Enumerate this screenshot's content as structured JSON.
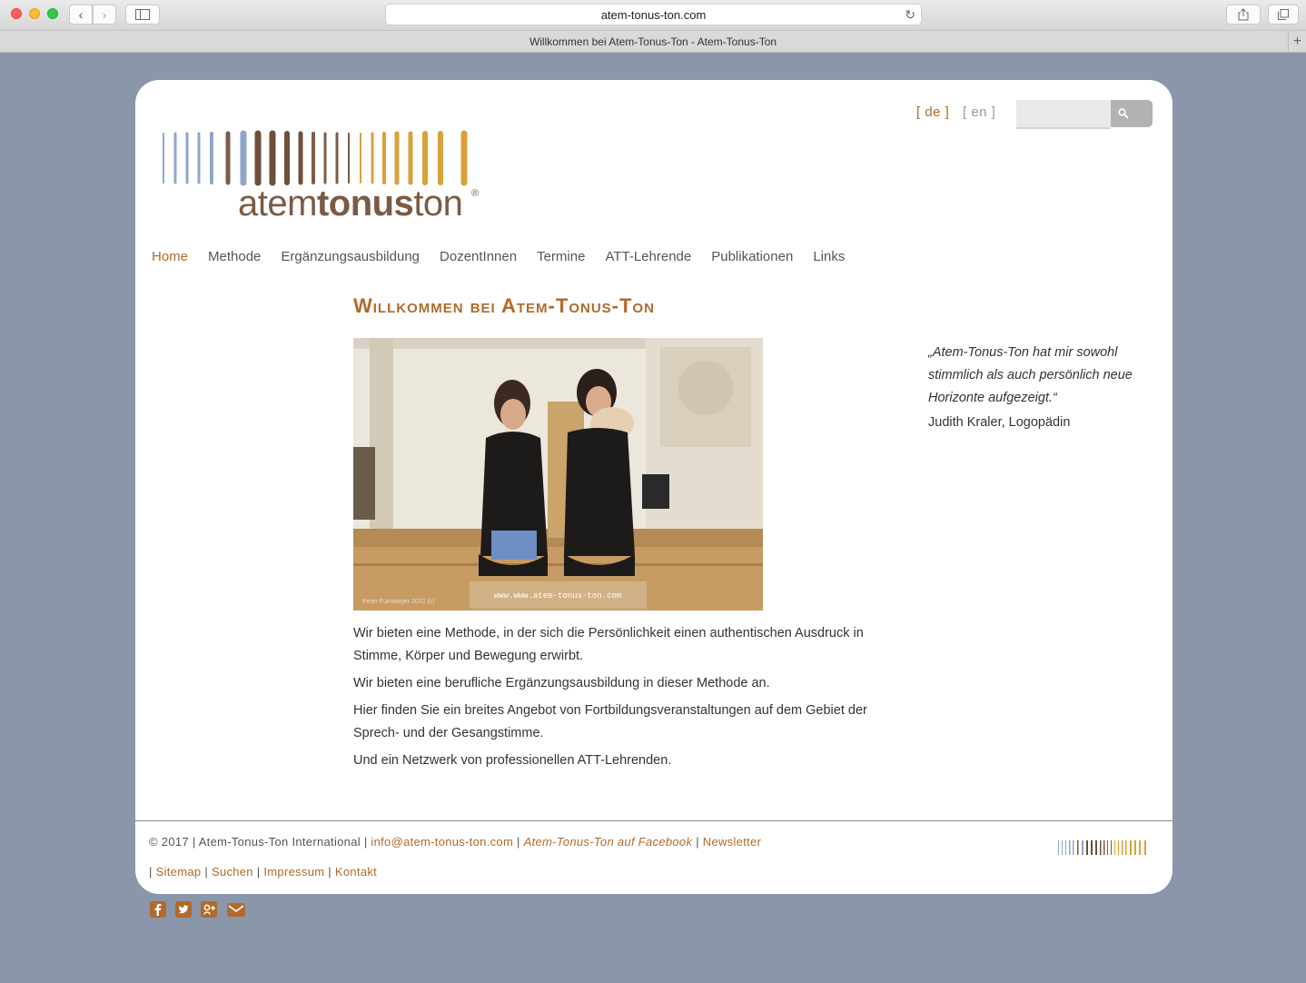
{
  "browser": {
    "url": "atem-tonus-ton.com",
    "tab_title": "Willkommen bei Atem-Tonus-Ton - Atem-Tonus-Ton"
  },
  "header": {
    "lang_de": "[ de ]",
    "lang_en": "[ en ]",
    "search_placeholder": "",
    "logo": {
      "text_light_1": "atem",
      "text_bold": "tonus",
      "text_light_2": "ton",
      "registered": "®"
    }
  },
  "nav": {
    "items": [
      "Home",
      "Methode",
      "Ergänzungsausbildung",
      "DozentInnen",
      "Termine",
      "ATT-Lehrende",
      "Publikationen",
      "Links"
    ],
    "active": "Home"
  },
  "main": {
    "title": "Willkommen bei Atem-Tonus-Ton",
    "photo_watermark": "www.www.atem-tonus-ton.com",
    "photo_credit": "Peter Fürnweger 2012 (c)",
    "paragraphs": [
      "Wir bieten eine Methode, in der sich die Persönlichkeit einen authentischen Ausdruck in Stimme, Körper und Bewegung erwirbt.",
      "Wir bieten eine berufliche Ergänzungsausbildung in dieser Methode an.",
      "Hier finden Sie ein breites Angebot von Fortbildungsveranstaltungen auf dem Gebiet der Sprech- und der Gesangstimme.",
      "Und ein Netzwerk von professionellen ATT-Lehrenden."
    ]
  },
  "sidebar": {
    "quote": "„Atem-Tonus-Ton hat mir sowohl stimmlich als auch persönlich neue Horizonte aufgezeigt.“",
    "author": "Judith Kraler, Logopädin"
  },
  "footer": {
    "copyright": "© 2017 | Atem-Tonus-Ton International |",
    "email": "info@atem-tonus-ton.com",
    "sep": "|",
    "facebook": "Atem-Tonus-Ton auf Facebook",
    "newsletter": "Newsletter",
    "links": [
      "Sitemap",
      "Suchen",
      "Impressum",
      "Kontakt"
    ]
  },
  "colors": {
    "accent": "#b06a2a",
    "page_bg": "#8a96aa",
    "logo_blue": "#8fa6c9",
    "logo_brown": "#6f4f3a",
    "logo_gold": "#d9a13a"
  }
}
